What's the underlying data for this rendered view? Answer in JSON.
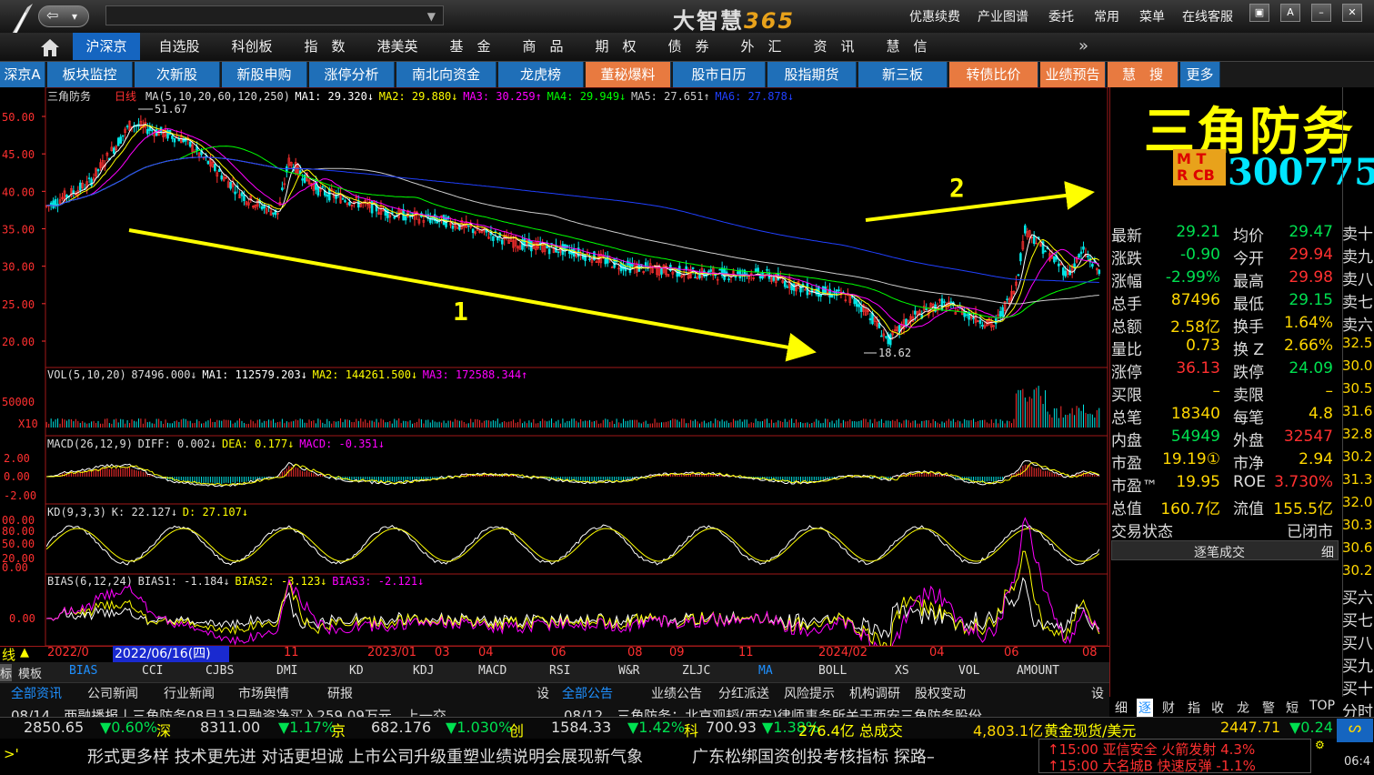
{
  "titlebar": {
    "brand_cn": "大智慧",
    "brand_num": "365",
    "menu": [
      "优惠续费",
      "产业图谱",
      "委托",
      "常用",
      "菜单",
      "在线客服"
    ]
  },
  "nav_tabs": [
    "沪深京",
    "自选股",
    "科创板",
    "指　数",
    "港美英",
    "基　金",
    "商　品",
    "期　权",
    "债　券",
    "外　汇",
    "资　讯",
    "慧　信"
  ],
  "sub_tabs": [
    "深京A",
    "板块监控",
    "次新股",
    "新股申购",
    "涨停分析",
    "南北向资金",
    "龙虎榜",
    "董秘爆料",
    "股市日历",
    "股指期货",
    "新三板",
    "转债比价",
    "业绩预告",
    "慧　搜",
    "更多"
  ],
  "chart": {
    "title": "三角防务",
    "period": "日线",
    "ma_header": [
      "MA(5,10,20,60,120,250)",
      "MA1: 29.320↓",
      "MA2: 29.880↓",
      "MA3: 30.259↑",
      "MA4: 29.949↓",
      "MA5: 27.651↑",
      "MA6: 27.878↓"
    ],
    "price_ticks": [
      "50.00",
      "45.00",
      "40.00",
      "35.00",
      "30.00",
      "25.00",
      "20.00"
    ],
    "high_label": "51.67",
    "low_label": "18.62",
    "arrow1_label": "1",
    "arrow2_label": "2",
    "vol_header": [
      "VOL(5,10,20)",
      "87496.000↓",
      "MA1: 112579.203↓",
      "MA2: 144261.500↓",
      "MA3: 172588.344↑"
    ],
    "vol_ticks": [
      "50000",
      "X10"
    ],
    "macd_header": [
      "MACD(26,12,9)",
      "DIFF: 0.002↓",
      "DEA: 0.177↓",
      "MACD: -0.351↓"
    ],
    "macd_ticks": [
      "2.00",
      "0.00",
      "-2.00"
    ],
    "kd_header": [
      "KD(9,3,3)",
      "K: 22.127↓",
      "D: 27.107↓"
    ],
    "kd_ticks": [
      "00.00",
      "80.00",
      "50.00",
      "20.00",
      "0.00"
    ],
    "bias_header": [
      "BIAS(6,12,24)",
      "BIAS1: -1.184↓",
      "BIAS2: -3.123↓",
      "BIAS3: -2.121↓"
    ],
    "bias_ticks": [
      "0.00"
    ],
    "date_axis": {
      "current": "2022/06/16(四)",
      "labels": [
        "2022/0",
        "06",
        "11",
        "2023/01",
        "03",
        "04",
        "06",
        "08",
        "09",
        "11",
        "2024/02",
        "04",
        "06",
        "08"
      ],
      "line_label": "线"
    }
  },
  "indicator_tabs": [
    "标",
    "模板",
    "BIAS",
    "CCI",
    "CJBS",
    "DMI",
    "KD",
    "KDJ",
    "MACD",
    "RSI",
    "W&R",
    "ZLJC",
    "MA",
    "BOLL",
    "XS",
    "VOL",
    "AMOUNT"
  ],
  "news": {
    "left_tabs": [
      "全部资讯",
      "公司新闻",
      "行业新闻",
      "市场舆情",
      "研报",
      "设"
    ],
    "right_tabs": [
      "全部公告",
      "业绩公告",
      "分红派送",
      "风险提示",
      "机构调研",
      "股权变动",
      "设"
    ],
    "left_line": "08/14　两融播报丨三角防务08月13日融资净买入259.09万元，上一交",
    "right_line": "08/12　三角防务：北京观韬(西安)律师事务所关于西安三角防务股份"
  },
  "quote": {
    "name": "三角防务",
    "badge_line1": "M T",
    "badge_line2": "R CB",
    "code": "300775",
    "rows": [
      [
        "最新",
        "29.21",
        "均价",
        "29.47"
      ],
      [
        "涨跌",
        "-0.90",
        "今开",
        "29.94"
      ],
      [
        "涨幅",
        "-2.99%",
        "最高",
        "29.98"
      ],
      [
        "总手",
        "87496",
        "最低",
        "29.15"
      ],
      [
        "总额",
        "2.58亿",
        "换手",
        "1.64%"
      ],
      [
        "量比",
        "0.73",
        "换 Z",
        "2.66%"
      ],
      [
        "涨停",
        "36.13",
        "跌停",
        "24.09"
      ],
      [
        "买限",
        "–",
        "卖限",
        "–"
      ],
      [
        "总笔",
        "18340",
        "每笔",
        "4.8"
      ],
      [
        "内盘",
        "54949",
        "外盘",
        "32547"
      ],
      [
        "市盈",
        "19.19①",
        "市净",
        "2.94"
      ],
      [
        "市盈™",
        "19.95",
        "ROE",
        "3.730%"
      ],
      [
        "总值",
        "160.7亿",
        "流值",
        "155.5亿"
      ],
      [
        "交易状态",
        "",
        "",
        "已闭市"
      ]
    ],
    "tick_header": "逐笔成交",
    "tick_detail": "细",
    "side_orders": [
      "卖十",
      "卖九",
      "卖八",
      "卖七",
      "卖六",
      "32.5",
      "30.0",
      "30.5",
      "31.6",
      "32.8",
      "30.2",
      "31.3",
      "32.0",
      "30.3",
      "30.6",
      "30.2",
      "买六",
      "买七",
      "买八",
      "买九",
      "买十",
      "分时"
    ],
    "bottom_tabs": [
      "细",
      "逐",
      "财",
      "指",
      "收",
      "龙",
      "警",
      "短",
      "TOP"
    ]
  },
  "status": [
    {
      "v": "2850.65",
      "c": "▼0.60%",
      "t": "深"
    },
    {
      "v": "8311.00",
      "c": "▼1.17%",
      "t": "京"
    },
    {
      "v": "682.176",
      "c": "▼1.030%",
      "t": "创"
    },
    {
      "v": "1584.33",
      "c": "▼1.42%",
      "t": "科"
    },
    {
      "v": "700.93",
      "c": "▼1.38%",
      "t": "276.4亿 总成交"
    }
  ],
  "gold": {
    "amount": "4,803.1亿",
    "label": "黄金现货/美元",
    "price": "2447.71",
    "change": "▼0.24"
  },
  "ticker": {
    "prefix": ">'",
    "text": "形式更多样 技术更先进 对话更坦诚 上市公司升级重塑业绩说明会展现新气象　　　广东松绑国资创投考核指标 探路–",
    "alerts": [
      "15:00 亚信安全 火箭发射 4.3%",
      "15:00 大名城B 快速反弹 -1.1%"
    ],
    "clock": "06:4"
  },
  "colors": {
    "up": "#ff3030",
    "down": "#00e050",
    "accent": "#1f6fb8",
    "orange": "#e87a40",
    "yellow": "#ffff00",
    "ma1": "#ffffff",
    "ma2": "#ffff00",
    "ma3": "#ff00ff",
    "ma4": "#00ff00",
    "ma5": "#cccccc",
    "ma6": "#2040ff"
  }
}
